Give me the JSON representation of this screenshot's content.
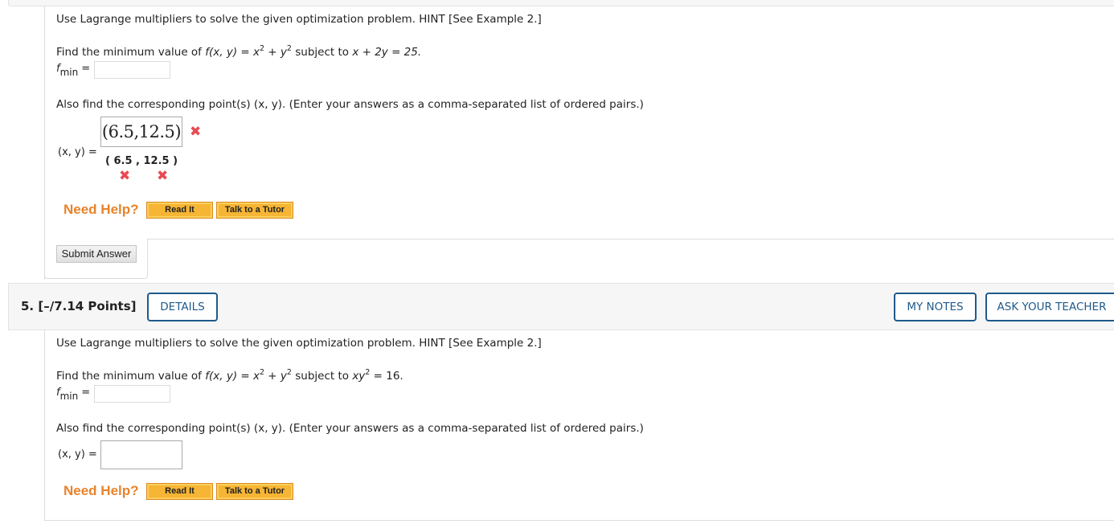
{
  "question4": {
    "intro": "Use Lagrange multipliers to solve the given optimization problem. HINT [See Example 2.]",
    "find_prefix": "Find the minimum value of ",
    "func": "f(x, y) = x",
    "exp1": "2",
    "plus": " + y",
    "exp2": "2",
    "subject": " subject to ",
    "constraint": "x + 2y = 25.",
    "fmin_label": "f",
    "fmin_sub": "min",
    "fmin_eq": "=",
    "fmin_value": "",
    "also_find": "Also find the corresponding point(s) (x, y). (Enter your answers as a comma-separated list of ordered pairs.)",
    "xy_label": "(x, y) =",
    "xy_answer": "(6.5,12.5)",
    "xy_answer_status": "incorrect",
    "parsed_answer": "( 6.5 , 12.5 )",
    "parsed_x": "6.5",
    "parsed_y": "12.5",
    "parsed_x_status": "incorrect",
    "parsed_y_status": "incorrect",
    "mark_glyph": "✖",
    "need_help": "Need Help?",
    "read_it": "Read It",
    "talk_tutor": "Talk to a Tutor",
    "submit": "Submit Answer"
  },
  "question5": {
    "number_label": "5. [–/7.14 Points]",
    "details": "DETAILS",
    "my_notes": "MY NOTES",
    "ask_teacher": "ASK YOUR TEACHER",
    "intro": "Use Lagrange multipliers to solve the given optimization problem. HINT [See Example 2.]",
    "find_prefix": "Find the minimum value of ",
    "func": "f(x, y) = x",
    "exp1": "2",
    "plus": " + y",
    "exp2": "2",
    "subject": " subject to ",
    "constraint": "xy",
    "constraint_exp": "2",
    "constraint_rest": " = 16.",
    "fmin_label": "f",
    "fmin_sub": "min",
    "fmin_eq": "=",
    "fmin_value": "",
    "also_find": "Also find the corresponding point(s) (x, y). (Enter your answers as a comma-separated list of ordered pairs.)",
    "xy_label": "(x, y) =",
    "xy_value": "",
    "need_help": "Need Help?",
    "read_it": "Read It",
    "talk_tutor": "Talk to a Tutor"
  },
  "colors": {
    "error_red": "#e84a52",
    "help_orange": "#e8832a",
    "button_orange": "#f6b534",
    "accent_blue": "#1e5a8c"
  }
}
